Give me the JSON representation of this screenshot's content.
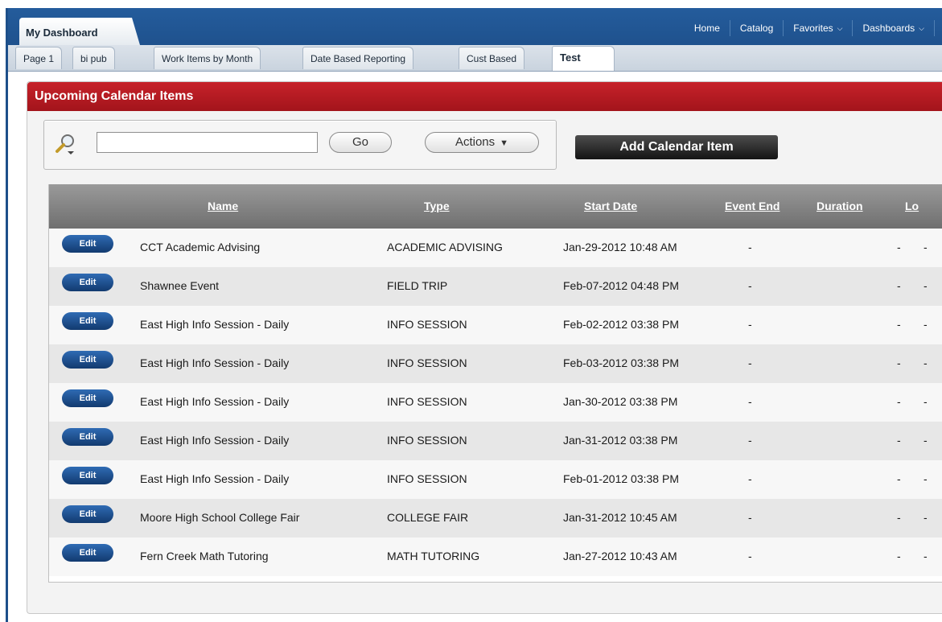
{
  "header": {
    "dashboard_tab": "My Dashboard",
    "nav": [
      {
        "label": "Home",
        "has_menu": false
      },
      {
        "label": "Catalog",
        "has_menu": false
      },
      {
        "label": "Favorites",
        "has_menu": true
      },
      {
        "label": "Dashboards",
        "has_menu": true
      }
    ],
    "menu_icon": "chevron-down-icon"
  },
  "page_tabs": [
    {
      "label": "Page 1",
      "active": false
    },
    {
      "label": "bi pub",
      "active": false
    },
    {
      "label": "Work Items by Month",
      "active": false
    },
    {
      "label": "Date Based Reporting",
      "active": false
    },
    {
      "label": "Cust Based",
      "active": false
    },
    {
      "label": "Test",
      "active": true
    }
  ],
  "panel": {
    "title": "Upcoming Calendar Items",
    "title_color": "#b31b22"
  },
  "search": {
    "icon": "search-icon",
    "value": "",
    "go_label": "Go",
    "actions_label": "Actions"
  },
  "add_button_label": "Add Calendar Item",
  "table": {
    "columns": [
      "Name",
      "Type",
      "Start Date",
      "Event End",
      "Duration",
      "Lo"
    ],
    "edit_label": "Edit",
    "rows": [
      {
        "name": "CCT Academic Advising",
        "type": "ACADEMIC ADVISING",
        "start": "Jan-29-2012 10:48 AM",
        "end": "-",
        "duration": "-",
        "location": "-"
      },
      {
        "name": "Shawnee Event",
        "type": "FIELD TRIP",
        "start": "Feb-07-2012 04:48 PM",
        "end": "-",
        "duration": "-",
        "location": "-"
      },
      {
        "name": "East High Info Session - Daily",
        "type": "INFO SESSION",
        "start": "Feb-02-2012 03:38 PM",
        "end": "-",
        "duration": "-",
        "location": "-"
      },
      {
        "name": "East High Info Session - Daily",
        "type": "INFO SESSION",
        "start": "Feb-03-2012 03:38 PM",
        "end": "-",
        "duration": "-",
        "location": "-"
      },
      {
        "name": "East High Info Session - Daily",
        "type": "INFO SESSION",
        "start": "Jan-30-2012 03:38 PM",
        "end": "-",
        "duration": "-",
        "location": "-"
      },
      {
        "name": "East High Info Session - Daily",
        "type": "INFO SESSION",
        "start": "Jan-31-2012 03:38 PM",
        "end": "-",
        "duration": "-",
        "location": "-"
      },
      {
        "name": "East High Info Session - Daily",
        "type": "INFO SESSION",
        "start": "Feb-01-2012 03:38 PM",
        "end": "-",
        "duration": "-",
        "location": "-"
      },
      {
        "name": "Moore High School College Fair",
        "type": "COLLEGE FAIR",
        "start": "Jan-31-2012 10:45 AM",
        "end": "-",
        "duration": "-",
        "location": "-"
      },
      {
        "name": "Fern Creek Math Tutoring",
        "type": "MATH TUTORING",
        "start": "Jan-27-2012 10:43 AM",
        "end": "-",
        "duration": "-",
        "location": "-"
      }
    ]
  }
}
